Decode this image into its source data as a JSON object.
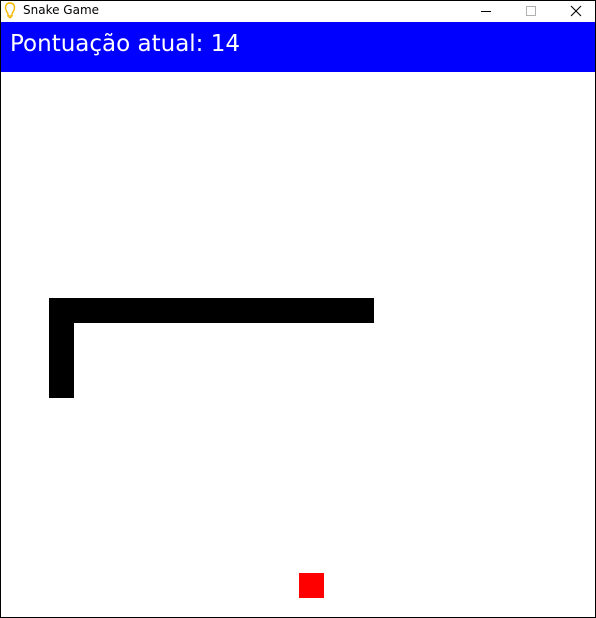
{
  "window": {
    "title": "Snake Game",
    "app_icon": "python-icon",
    "controls": {
      "minimize_icon": "minimize-icon",
      "maximize_icon": "maximize-icon",
      "close_icon": "close-icon"
    }
  },
  "header": {
    "score_text": "Pontuação atual: 14",
    "background_color": "#0000ff",
    "text_color": "#ffffff"
  },
  "game": {
    "board_color": "#ffffff",
    "snake_color": "#000000",
    "food_color": "#ff0000"
  }
}
